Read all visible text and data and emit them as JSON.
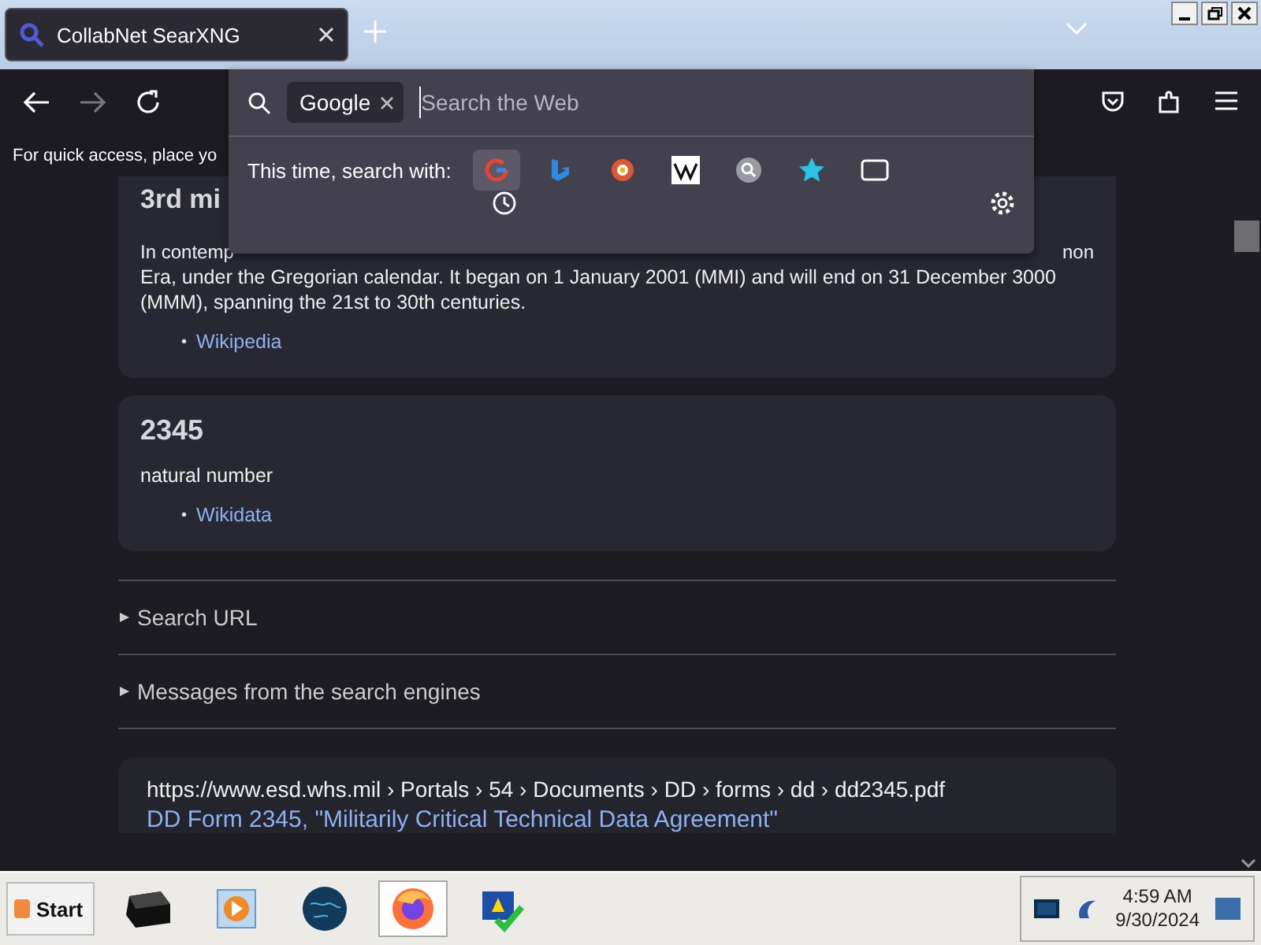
{
  "tabs": [
    {
      "title": "CollabNet SearXNG",
      "selected": true
    }
  ],
  "bookmarks_bar": {
    "text": "For quick access, place yo"
  },
  "search_popup": {
    "engine_chip": "Google",
    "placeholder": "Search the Web",
    "prompt": "This time, search with:",
    "engines": [
      {
        "kind": "google",
        "selected": true
      },
      {
        "kind": "bing",
        "selected": false
      },
      {
        "kind": "duckduckgo",
        "selected": false
      },
      {
        "kind": "wikipedia",
        "selected": false
      },
      {
        "kind": "searxng",
        "selected": false
      },
      {
        "kind": "bookmarks",
        "selected": false
      },
      {
        "kind": "tabs",
        "selected": false
      }
    ]
  },
  "infoboxes": [
    {
      "title": "3rd mi",
      "text_start": "In contemp",
      "text_end": "non",
      "text": "Era, under the Gregorian calendar. It began on 1 January 2001 (MMI) and will end on 31 December 3000 (MMM), spanning the 21st to 30th centuries.",
      "links": [
        {
          "bullet": "•",
          "label": "Wikipedia"
        }
      ]
    },
    {
      "title": "2345",
      "text_start": "natural number",
      "links": [
        {
          "bullet": "•",
          "label": "Wikidata"
        }
      ]
    }
  ],
  "sections": [
    {
      "label": "Search URL",
      "expanded": false
    },
    {
      "label": "Messages from the search engines",
      "expanded": false
    }
  ],
  "result": {
    "url": "https://www.esd.whs.mil",
    "breadcrumb": "› Portals › 54 › Documents › DD › forms › dd › dd2345.pdf",
    "title": "DD Form 2345, \"Militarily Critical Technical Data Agreement\""
  },
  "taskbar": {
    "start": "Start",
    "apps": [
      {
        "kind": "drive",
        "selected": false
      },
      {
        "kind": "media",
        "selected": false
      },
      {
        "kind": "globe",
        "selected": false
      },
      {
        "kind": "firefox",
        "selected": true
      },
      {
        "kind": "setup",
        "selected": false
      }
    ],
    "time": "4:59 AM",
    "date": "9/30/2024"
  }
}
